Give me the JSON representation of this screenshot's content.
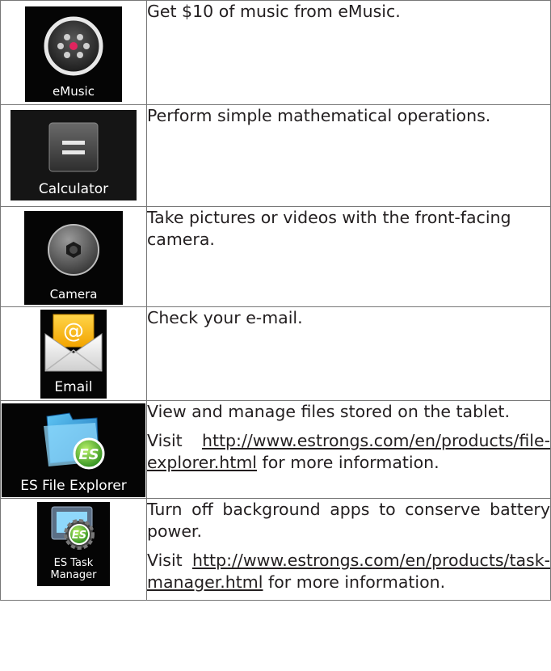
{
  "rows": [
    {
      "app": "eMusic",
      "description": [
        "Get $10 of music from eMusic."
      ]
    },
    {
      "app": "Calculator",
      "description": [
        "Perform simple mathematical operations."
      ]
    },
    {
      "app": "Camera",
      "description": [
        "Take pictures or videos with the front-facing camera."
      ]
    },
    {
      "app": "Email",
      "description": [
        "Check your e-mail."
      ]
    },
    {
      "app": "ES File Explorer",
      "description": [
        "View and manage files stored on the tablet."
      ],
      "visit_prefix": "Visit",
      "link": "http://www.estrongs.com/en/products/file-explorer.html",
      "visit_suffix": "for more information."
    },
    {
      "app": "ES Task\nManager",
      "description": [
        "Turn off background apps to conserve battery power."
      ],
      "visit_prefix": "Visit",
      "link": "http://www.estrongs.com/en/products/task-manager.html",
      "visit_suffix": "for more information."
    }
  ]
}
